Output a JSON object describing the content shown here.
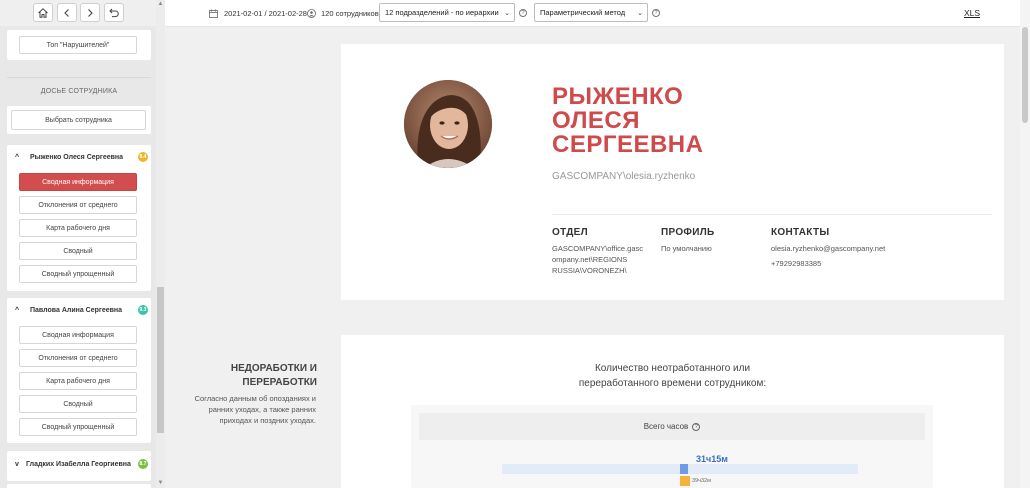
{
  "sidebar": {
    "top_violators_button": "Топ \"Нарушителей\"",
    "section_title": "ДОСЬЕ СОТРУДНИКА",
    "select_employee_button": "Выбрать сотрудника",
    "employees": [
      {
        "name": "Рыженко Олеся Сергеевна",
        "badge": "8.4",
        "badge_color": "#f0b429",
        "expanded": true,
        "items": [
          "Сводная информация",
          "Отклонения от среднего",
          "Карта рабочего дня",
          "Сводный",
          "Сводный упрощенный"
        ],
        "active_index": 0
      },
      {
        "name": "Павлова Алина Сергеевна",
        "badge": "9.3",
        "badge_color": "#3cc3a7",
        "expanded": true,
        "items": [
          "Сводная информация",
          "Отклонения от среднего",
          "Карта рабочего дня",
          "Сводный",
          "Сводный упрощенный"
        ]
      },
      {
        "name": "Гладких Изабелла Георгиевна",
        "badge": "8.7",
        "badge_color": "#7cc043",
        "expanded": false
      }
    ]
  },
  "topbar": {
    "date_range": "2021-02-01 / 2021-02-28",
    "employees_count": "120 сотрудников",
    "departments_select": "12 подразделений - по иерархии",
    "method_select": "Параметрический метод",
    "xls_link": "XLS"
  },
  "profile": {
    "name_lines": [
      "РЫЖЕНКО",
      "ОЛЕСЯ",
      "СЕРГЕЕВНА"
    ],
    "login": "GASCOMPANY\\olesia.ryzhenko",
    "department_header": "ОТДЕЛ",
    "department_value_lines": [
      "GASCOMPANY\\office.gasc",
      "ompany.net\\REGIONS",
      "RUSSIA\\VORONEZH\\"
    ],
    "profile_header": "ПРОФИЛЬ",
    "profile_value": "По умолчанию",
    "contacts_header": "КОНТАКТЫ",
    "email": "olesia.ryzhenko@gascompany.net",
    "phone": "+79292983385"
  },
  "stats": {
    "title_lines": [
      "НЕДОРАБОТКИ И",
      "ПЕРЕРАБОТКИ"
    ],
    "description_lines": [
      "Согласно данным об опозданиях и",
      "ранних уходах, а также ранних",
      "приходах и поздних уходах."
    ],
    "chart_title_lines": [
      "Количество неотработанного или",
      "переработанного времени сотрудником:"
    ],
    "total_hours_label": "Всего часов",
    "bar_value_label": "31ч15м",
    "bar_value_label_2": "39ч32м"
  },
  "chart_data": {
    "type": "bar",
    "categories": [
      "Всего часов"
    ],
    "series": [
      {
        "values": [
          31.25
        ],
        "label": "31ч15м",
        "color": "#6e9be6"
      },
      {
        "values": [
          39.53
        ],
        "label": "39ч32м",
        "color": "#f2b33d"
      }
    ]
  },
  "colors": {
    "accent_red": "#cf4a4a",
    "active_button": "#d24d4d",
    "bar_blue": "#6e9be6",
    "bar_orange": "#f2b33d"
  },
  "icons": [
    "home-icon",
    "back-icon",
    "forward-icon",
    "undo-icon",
    "calendar-icon",
    "people-icon",
    "help-icon",
    "chevron-up-icon",
    "chevron-down-icon"
  ]
}
